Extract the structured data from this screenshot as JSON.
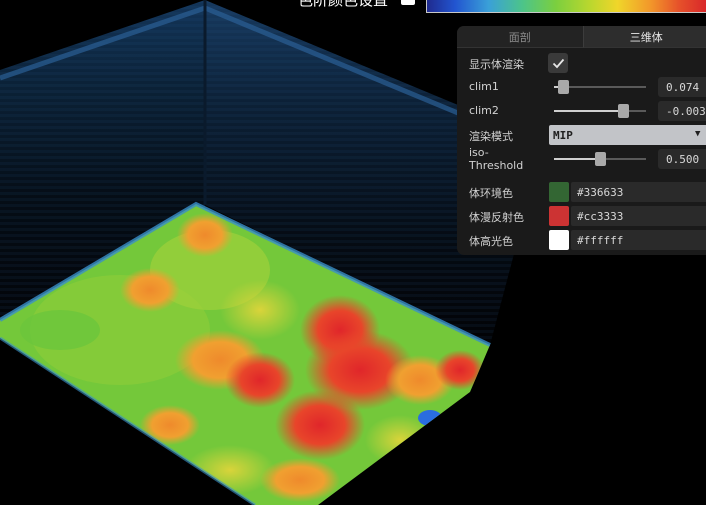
{
  "header": {
    "colormap_label": "色阶颜色设置"
  },
  "panel": {
    "tabs": [
      "面剖",
      "三维体"
    ],
    "active_tab": "三维体",
    "show_volume": {
      "label": "显示体渲染",
      "checked": true
    },
    "clim1": {
      "label": "clim1",
      "value": "0.074",
      "level": 0.1
    },
    "clim2": {
      "label": "clim2",
      "value": "-0.003",
      "level": 0.75
    },
    "render_mode": {
      "label": "渲染模式",
      "value": "MIP"
    },
    "iso_threshold": {
      "label_line1": "iso-",
      "label_line2": "Threshold",
      "value": "0.500",
      "level": 0.5
    },
    "ambient_color": {
      "label": "体环境色",
      "value": "#336633",
      "color": "#336633"
    },
    "diffuse_color": {
      "label": "体漫反射色",
      "value": "#cc3333",
      "color": "#cc3333"
    },
    "specular_color": {
      "label": "体高光色",
      "value": "#ffffff",
      "color": "#ffffff"
    }
  },
  "icons": {
    "checkbox": "check-icon",
    "select_arrow": "chevron-down-icon"
  }
}
